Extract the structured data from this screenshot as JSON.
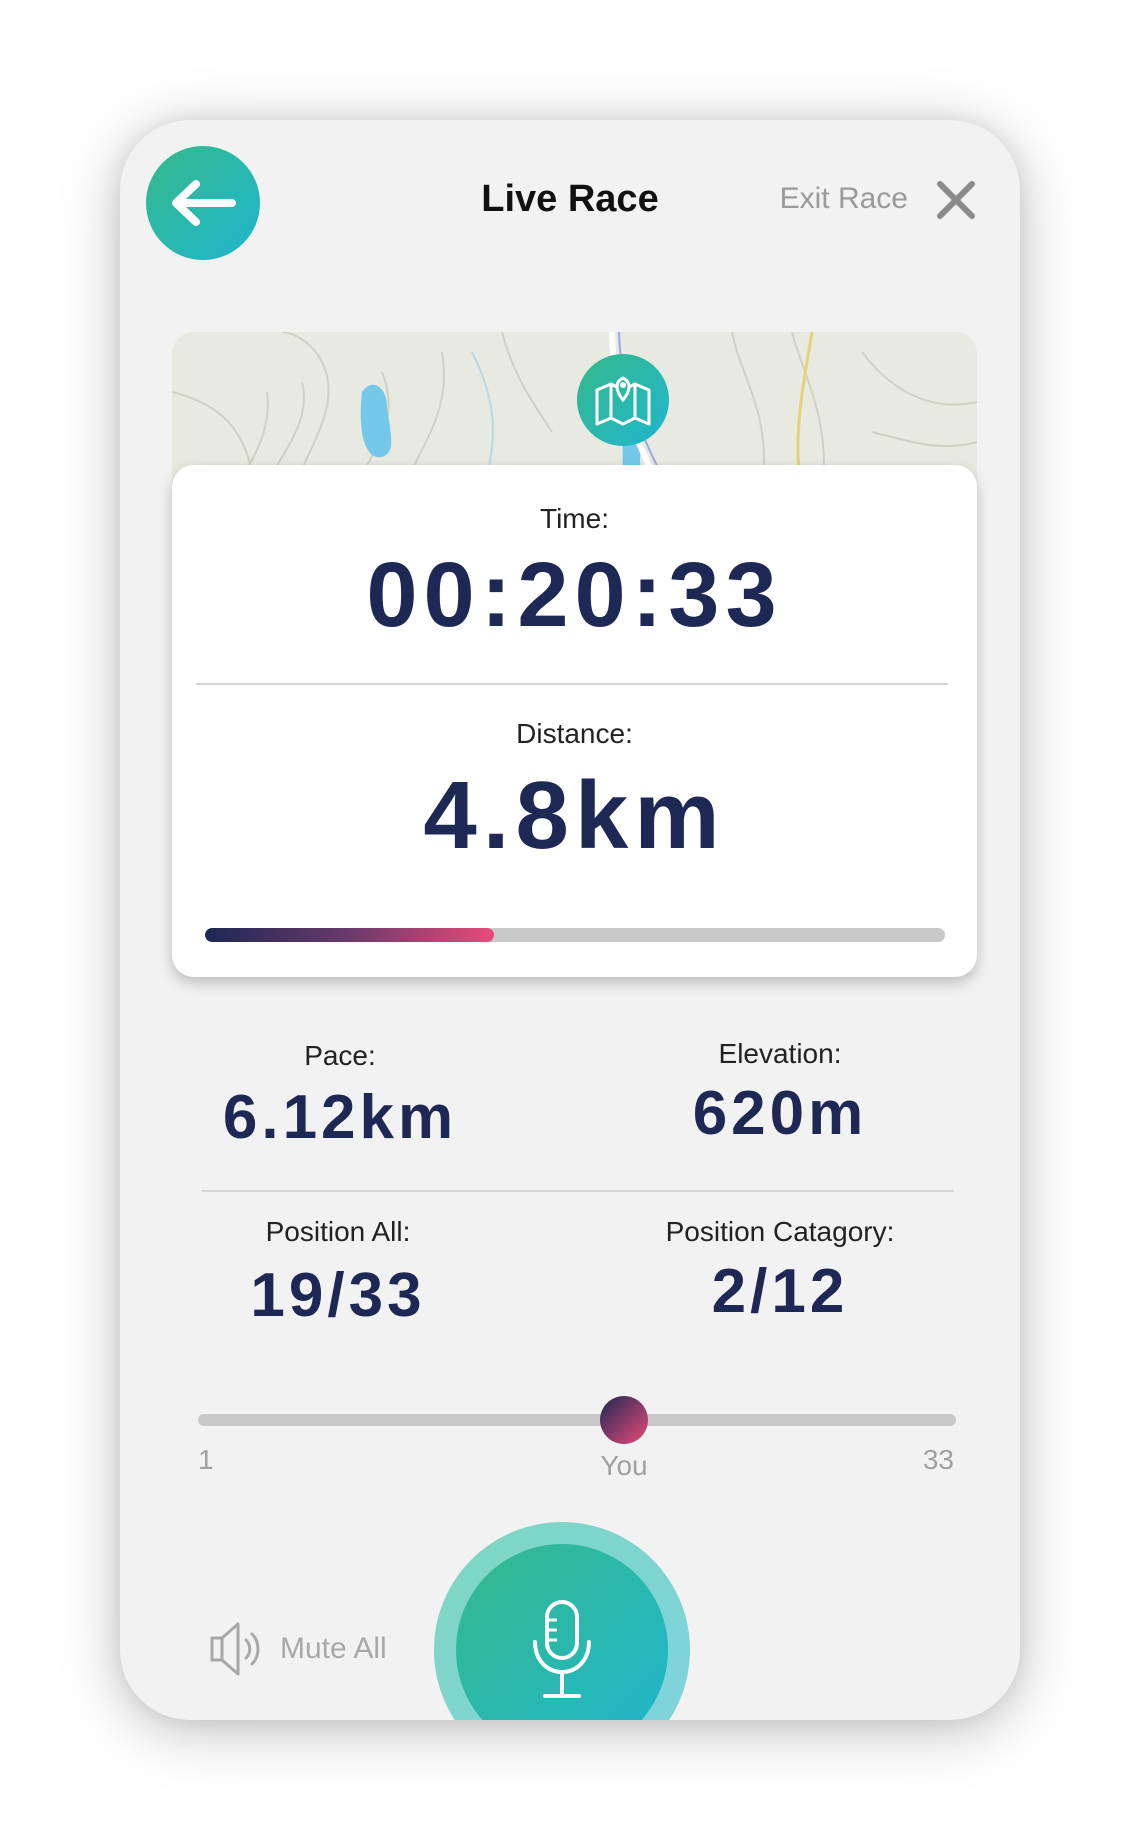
{
  "header": {
    "title": "Live Race",
    "exit_label": "Exit Race"
  },
  "time": {
    "label": "Time:",
    "value": "00:20:33"
  },
  "distance": {
    "label": "Distance:",
    "value": "4.8km",
    "progress": 0.39
  },
  "stats": {
    "pace": {
      "label": "Pace:",
      "value": "6.12km"
    },
    "elevation": {
      "label": "Elevation:",
      "value": "620m"
    },
    "position_all": {
      "label": "Position All:",
      "value": "19/33"
    },
    "position_category": {
      "label": "Position Catagory:",
      "value": "2/12"
    }
  },
  "ranking": {
    "min_label": "1",
    "max_label": "33",
    "you_label": "You",
    "position": 19,
    "total": 33
  },
  "controls": {
    "mute_label": "Mute All"
  },
  "icons": {
    "back": "arrow-left-icon",
    "close": "close-icon",
    "map": "map-pin-icon",
    "speaker": "speaker-icon",
    "mic": "microphone-icon"
  },
  "colors": {
    "accent_start": "#35b98a",
    "accent_end": "#1fb6cf",
    "value_text": "#1e2855",
    "progress_end": "#e94a7a"
  }
}
